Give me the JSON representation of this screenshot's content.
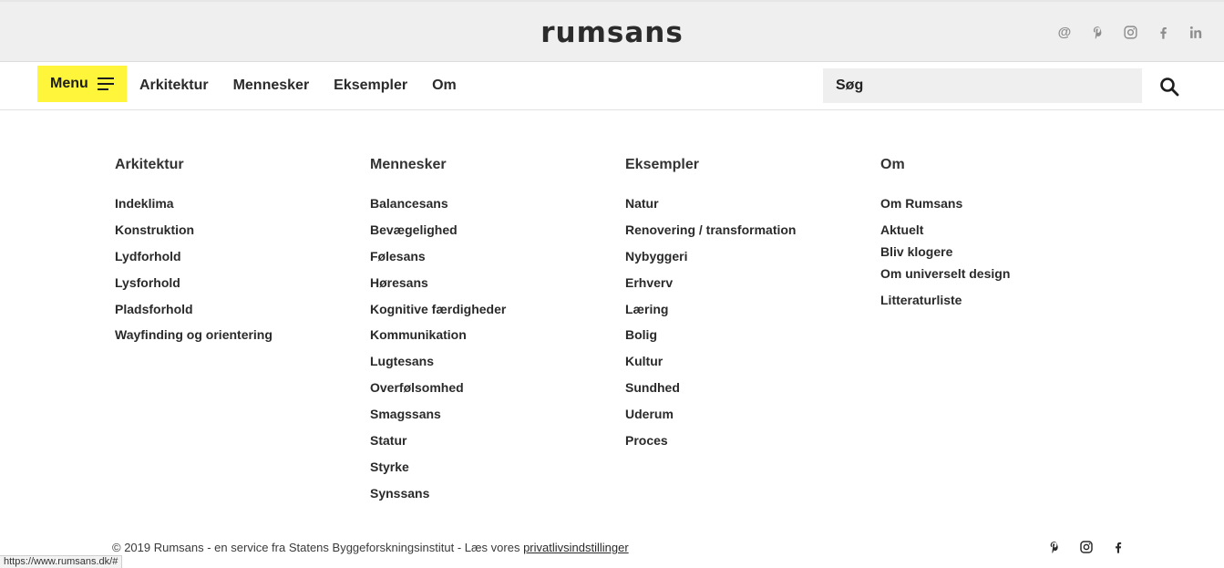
{
  "header": {
    "logo": "rumsans",
    "social_icons": [
      "at-icon",
      "pinterest-icon",
      "instagram-icon",
      "facebook-icon",
      "linkedin-icon"
    ]
  },
  "nav": {
    "menu_label": "Menu",
    "links": [
      "Arkitektur",
      "Mennesker",
      "Eksempler",
      "Om"
    ],
    "search_placeholder": "Søg"
  },
  "columns": [
    {
      "title": "Arkitektur",
      "items": [
        "Indeklima",
        "Konstruktion",
        "Lydforhold",
        "Lysforhold",
        "Pladsforhold",
        "Wayfinding og orientering"
      ]
    },
    {
      "title": "Mennesker",
      "items": [
        "Balancesans",
        "Bevægelighed",
        "Følesans",
        "Høresans",
        "Kognitive færdigheder",
        "Kommunikation",
        "Lugtesans",
        "Overfølsomhed",
        "Smagssans",
        "Statur",
        "Styrke",
        "Synssans"
      ]
    },
    {
      "title": "Eksempler",
      "items": [
        "Natur",
        "Renovering / transformation",
        "Nybyggeri",
        "Erhverv",
        "Læring",
        "Bolig",
        "Kultur",
        "Sundhed",
        "Uderum",
        "Proces"
      ]
    },
    {
      "title": "Om",
      "items": [
        "Om Rumsans",
        "Aktuelt",
        "Bliv klogere",
        "Om universelt design",
        "Litteraturliste"
      ]
    }
  ],
  "footer": {
    "copyright": "© 2019 Rumsans - en service fra Statens Byggeforskningsinstitut - Læs vores ",
    "privacy_link": "privatlivsindstillinger",
    "social_icons": [
      "pinterest-icon",
      "instagram-icon",
      "facebook-icon"
    ]
  },
  "status_bar": {
    "url": "https://www.rumsans.dk/#"
  },
  "colors": {
    "menu_button": "#fff53a",
    "header_bg": "#efefef",
    "search_bg": "#efefef"
  }
}
